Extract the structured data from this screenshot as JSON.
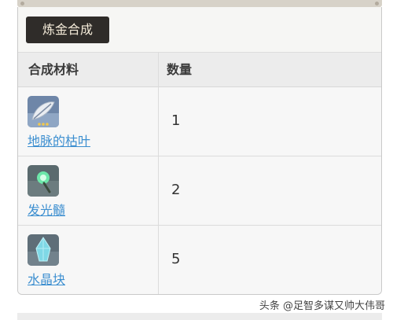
{
  "header": {
    "title": "炼金合成"
  },
  "table": {
    "columns": [
      "合成材料",
      "数量"
    ],
    "rows": [
      {
        "name": "地脉的枯叶",
        "quantity": "1",
        "icon": "withered-leaf-icon",
        "rarity_stars": 3
      },
      {
        "name": "发光髓",
        "quantity": "2",
        "icon": "luminescent-pith-icon"
      },
      {
        "name": "水晶块",
        "quantity": "5",
        "icon": "crystal-chunk-icon"
      }
    ]
  },
  "watermark": "头条 @足智多谋又帅大伟哥",
  "colors": {
    "title_bg": "#2f2c29",
    "link": "#3d8fd0",
    "header_bg": "#ececec"
  }
}
